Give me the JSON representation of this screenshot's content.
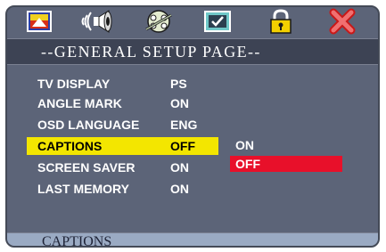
{
  "icons": [
    {
      "name": "tv-display-icon"
    },
    {
      "name": "audio-speaker-icon"
    },
    {
      "name": "video-reel-icon"
    },
    {
      "name": "preference-checkbox-icon"
    },
    {
      "name": "lock-icon"
    },
    {
      "name": "exit-icon"
    }
  ],
  "header": {
    "title": "--GENERAL SETUP PAGE--"
  },
  "settings": [
    {
      "label": "TV DISPLAY",
      "value": "PS"
    },
    {
      "label": "ANGLE MARK",
      "value": "ON"
    },
    {
      "label": "OSD LANGUAGE",
      "value": "ENG"
    },
    {
      "label": "CAPTIONS",
      "value": "OFF"
    },
    {
      "label": "SCREEN SAVER",
      "value": "ON"
    },
    {
      "label": "LAST MEMORY",
      "value": "ON"
    }
  ],
  "selected_index": 3,
  "options": [
    {
      "label": "ON",
      "active": false
    },
    {
      "label": "OFF",
      "active": true
    }
  ],
  "status": {
    "text": "CAPTIONS"
  },
  "colors": {
    "highlight": "#f3e600",
    "active_option": "#e8102a",
    "panel": "#5c6478",
    "status_bar": "#9aaac3"
  }
}
